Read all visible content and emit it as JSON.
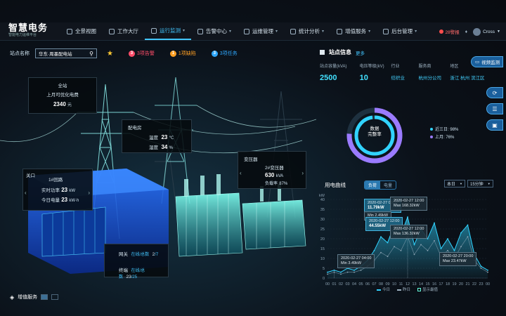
{
  "app": {
    "logo_title": "智慧电务",
    "logo_sub": "智能电力运维平台"
  },
  "nav": [
    {
      "label": "全景视图",
      "icon": "monitor-icon",
      "caret": false
    },
    {
      "label": "工作大厅",
      "icon": "briefcase-icon",
      "caret": false
    },
    {
      "label": "运行监测",
      "icon": "pulse-icon",
      "caret": true,
      "active": true
    },
    {
      "label": "告警中心",
      "icon": "bell-icon",
      "caret": true
    },
    {
      "label": "运维管理",
      "icon": "wrench-icon",
      "caret": true
    },
    {
      "label": "统计分析",
      "icon": "bar-chart-icon",
      "caret": true
    },
    {
      "label": "增值服务",
      "icon": "grid-icon",
      "caret": true
    },
    {
      "label": "后台管理",
      "icon": "settings-icon",
      "caret": true
    }
  ],
  "topright": {
    "alarm_text": "28警报",
    "user": "Cross"
  },
  "toolbar": {
    "station_label": "站点名称",
    "station_value": "华东·周墨配电站",
    "alarm": {
      "count": "3",
      "text": "3项告警",
      "color": "#ff4d6a"
    },
    "defect": {
      "count": "1",
      "text": "1项缺陷",
      "color": "#ffa024"
    },
    "task": {
      "count": "3",
      "text": "3项任务",
      "color": "#2fa8ff"
    }
  },
  "scene": {
    "total": {
      "title": "全站",
      "sub": "上月可优化电费",
      "value": "2340",
      "unit": "元"
    },
    "room": {
      "title": "配电房",
      "temp_label": "温度",
      "temp_value": "23",
      "temp_unit": "℃",
      "hum_label": "湿度",
      "hum_value": "34",
      "hum_unit": "%"
    },
    "transformer": {
      "title": "变压器",
      "name": "2#变压器",
      "cap_value": "630",
      "cap_unit": "kVA",
      "load_label": "负载率",
      "load_value": "87%"
    },
    "loop": {
      "prefix": "关口",
      "title": "1#回路",
      "power_label": "实时功率",
      "power_value": "23",
      "power_unit": "kW",
      "energy_label": "今日电量",
      "energy_value": "23",
      "energy_unit": "kW·h"
    },
    "devices": {
      "gw_label": "网关",
      "gw_status": "在线/总数",
      "gw_value": "2",
      "gw_total": "/7",
      "term_label": "终端",
      "term_status": "在线/总数",
      "term_value": "23",
      "term_total": "/25"
    }
  },
  "info": {
    "title": "站点信息",
    "more": "更多",
    "labels": [
      "站点容量(kVA)",
      "电压等级(kV)",
      "行业",
      "服务商",
      "地区"
    ],
    "values": [
      "2500",
      "10",
      "纺织业",
      "杭州分公司",
      "浙江 杭州 滨江区"
    ]
  },
  "donut": {
    "label_line1": "数据",
    "label_line2": "完整率",
    "recent_label": "近三日",
    "recent_value": "98%",
    "month_label": "上月",
    "month_value": "76%"
  },
  "side_buttons": {
    "video": "视频监测"
  },
  "curve": {
    "title": "用电曲线",
    "seg_load": "负荷",
    "seg_energy": "电量",
    "date_sel": "本日",
    "interval_sel": "15分钟",
    "legend_today": "今日",
    "legend_yesterday": "昨日",
    "legend_peak": "显示最值",
    "tips": [
      {
        "time": "2020-02-27 00:00",
        "value": "11.79kW",
        "hl": true
      },
      {
        "time": "Min 2.49kW",
        "value": "",
        "hl": false
      },
      {
        "time": "2020-02-27 12:00",
        "value": "Max 168.32kW",
        "hl": false
      },
      {
        "time": "2020-02-27 12:00",
        "value": "44.55kW",
        "hl": true
      },
      {
        "time": "2020-02-27 12:00",
        "value": "Max 136.32kW",
        "hl": false
      },
      {
        "time": "2020-02-27 04:00",
        "value": "Min 3.49kW",
        "hl": false
      },
      {
        "time": "2020-02-27 20:00",
        "value": "Max 23.47kW",
        "hl": false
      }
    ]
  },
  "chart_data": {
    "type": "area",
    "title": "用电曲线",
    "ylabel": "kW",
    "ylim": [
      0,
      40
    ],
    "yticks": [
      0,
      5,
      10,
      15,
      20,
      25,
      30,
      35,
      40
    ],
    "x": [
      "00",
      "01",
      "02",
      "03",
      "04",
      "05",
      "06",
      "07",
      "08",
      "09",
      "10",
      "11",
      "12",
      "13",
      "14",
      "15",
      "16",
      "17",
      "18",
      "19",
      "20",
      "21",
      "22",
      "23",
      "00"
    ],
    "series": [
      {
        "name": "今日",
        "values": [
          3,
          4,
          3,
          5,
          4,
          6,
          9,
          14,
          21,
          18,
          27,
          22,
          31,
          17,
          25,
          20,
          28,
          15,
          20,
          14,
          23,
          27,
          12,
          6,
          4
        ]
      },
      {
        "name": "昨日",
        "values": [
          2,
          3,
          2,
          3,
          3,
          4,
          6,
          9,
          13,
          11,
          16,
          14,
          21,
          12,
          17,
          14,
          19,
          11,
          14,
          10,
          16,
          21,
          9,
          5,
          3
        ]
      }
    ],
    "grid": true
  }
}
